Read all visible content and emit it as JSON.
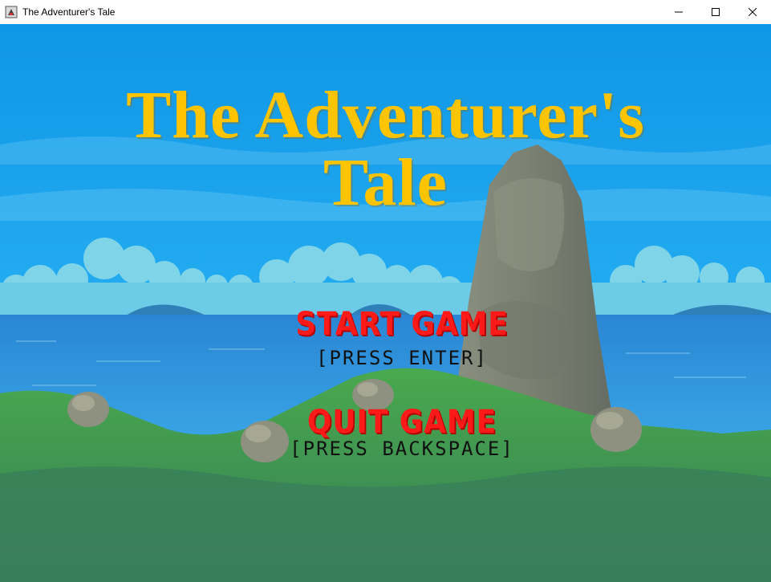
{
  "window": {
    "title": "The Adventurer's Tale",
    "controls": [
      "minimize-icon",
      "maximize-icon",
      "close-icon"
    ]
  },
  "game": {
    "title_line1": "The Adventurer's",
    "title_line2": "Tale",
    "menu": {
      "start_label": "START GAME",
      "start_hint": "[PRESS ENTER]",
      "quit_label": "QUIT GAME",
      "quit_hint": "[PRESS BACKSPACE]"
    }
  },
  "colors": {
    "sky": "#1aa3e8",
    "title": "#ffc400",
    "menu_label": "#ff1a1a",
    "menu_hint": "#111111",
    "sea": "#2c8fd6",
    "grass": "#3f9b4f",
    "rock": "#7a8276"
  }
}
